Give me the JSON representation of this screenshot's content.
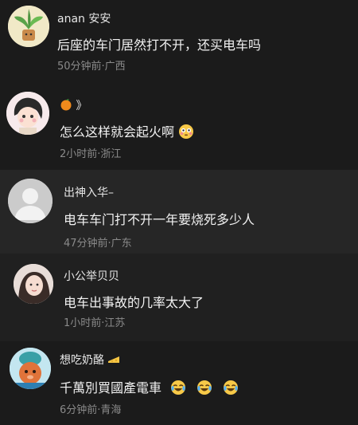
{
  "comments": [
    {
      "name": "anan 安安",
      "text": "后座的车门居然打不开，还买电车吗",
      "meta": "50分钟前·广西",
      "avatar_icon": "plant-avatar-icon"
    },
    {
      "name": "》",
      "text": "怎么这样就会起火啊",
      "meta": "2小时前·浙江",
      "avatar_icon": "girl-avatar-icon",
      "name_icon": "orange-icon",
      "text_emoji": "flushed-face-emoji"
    },
    {
      "name": "出神入华–",
      "text": "电车车门打不开一年要烧死多少人",
      "meta": "47分钟前·广东",
      "avatar_icon": "default-user-avatar-icon"
    },
    {
      "name": "小公举贝贝",
      "text": "电车出事故的几率太大了",
      "meta": "1小时前·江苏",
      "avatar_icon": "photo-avatar-icon"
    },
    {
      "name": "想吃奶酪",
      "text": "千萬別買國產電車",
      "meta": "6分钟前·青海",
      "avatar_icon": "cartoon-avatar-icon",
      "name_icon": "cheese-icon",
      "text_emoji": "crying-laughing-emoji"
    }
  ],
  "colors": {
    "background": "#1b1b1b",
    "highlight_row": "#262626",
    "name": "#e6e6e6",
    "text": "#f2f2f2",
    "meta": "#8a8a8a"
  }
}
